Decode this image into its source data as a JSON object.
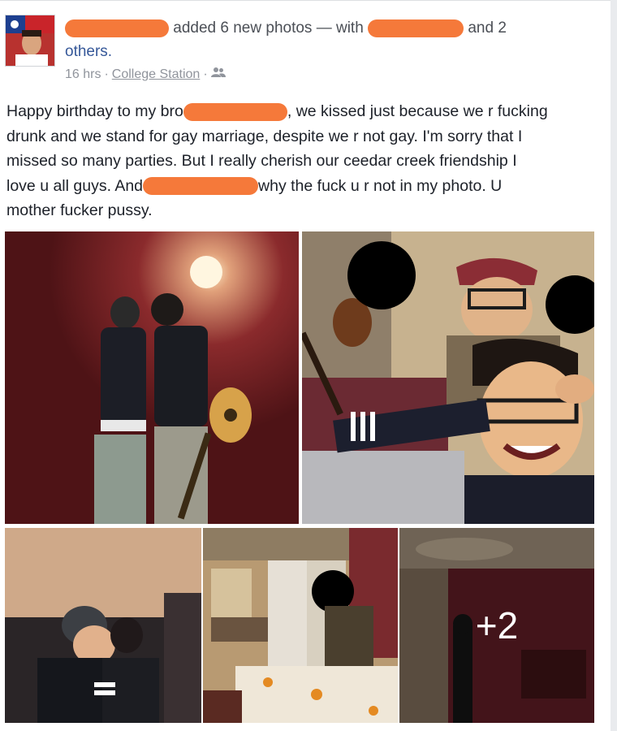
{
  "post": {
    "added_text": "added 6 new photos — with",
    "and_text": "and 2",
    "others_text": "others.",
    "time": "16 hrs",
    "separator": "·",
    "location": "College Station",
    "audience_icon": "friends-icon",
    "body_lines": {
      "l1a": "Happy birthday to my bro",
      "l1b": ", we kissed just because we r fucking",
      "l2": "drunk and we stand for gay marriage, despite we r not gay. I'm sorry that I",
      "l3": "missed so many parties. But I really cherish our ceedar creek friendship I",
      "l4a": "love u all guys. And",
      "l4b": "why the fuck u r not in my photo. U",
      "l5": "mother fucker pussy."
    },
    "more_photos_label": "+2"
  },
  "colors": {
    "redaction": "#f5793a",
    "link": "#365899",
    "meta": "#90949c",
    "wall_red": "#7a1f24"
  }
}
